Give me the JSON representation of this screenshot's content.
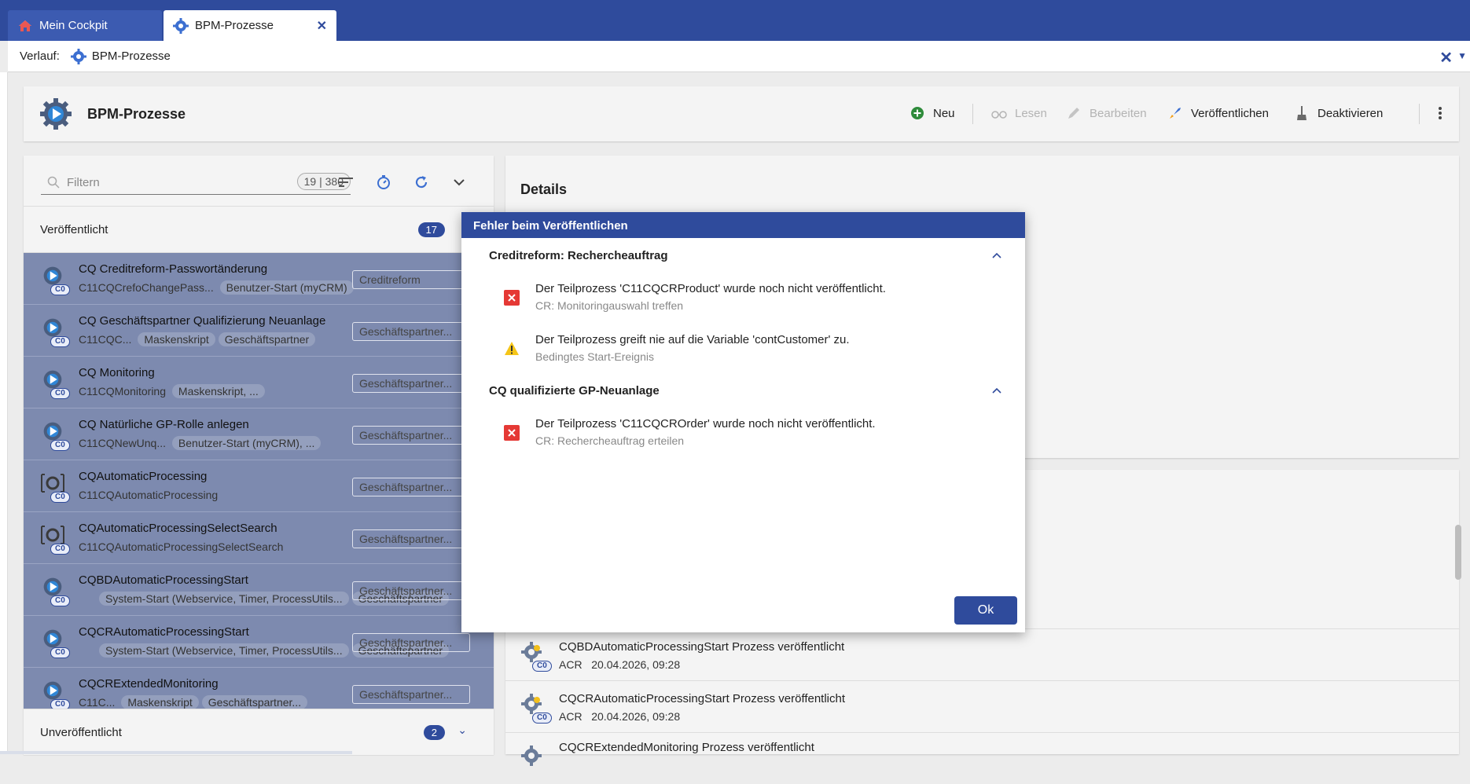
{
  "tabs": [
    {
      "label": "Mein Cockpit"
    },
    {
      "label": "BPM-Prozesse"
    }
  ],
  "history": {
    "label": "Verlauf:",
    "item": "BPM-Prozesse"
  },
  "header": {
    "title": "BPM-Prozesse",
    "actions": {
      "new": "Neu",
      "read": "Lesen",
      "edit": "Bearbeiten",
      "publish": "Veröffentlichen",
      "deactivate": "Deaktivieren"
    }
  },
  "filter": {
    "placeholder": "Filtern",
    "count": "19 | 380"
  },
  "sections": {
    "published": {
      "label": "Veröffentlicht",
      "count": "17"
    },
    "unpublished": {
      "label": "Unveröffentlicht",
      "count": "2"
    }
  },
  "rows": [
    {
      "name": "CQ Creditreform-Passwortänderung",
      "sub": "C11CQCrefoChangePass...",
      "chips": [
        "Benutzer-Start (myCRM)"
      ],
      "box": "Creditreform",
      "badge": "C0"
    },
    {
      "name": "CQ Geschäftspartner Qualifizierung Neuanlage",
      "sub": "C11CQC...",
      "chips": [
        "Maskenskript",
        "Geschäftspartner"
      ],
      "box": "Geschäftspartner...",
      "badge": "C0"
    },
    {
      "name": "CQ Monitoring",
      "sub": "C11CQMonitoring",
      "chips": [
        "Maskenskript, ..."
      ],
      "box": "Geschäftspartner...",
      "badge": "C0"
    },
    {
      "name": "CQ Natürliche GP-Rolle anlegen",
      "sub": "C11CQNewUnq...",
      "chips": [
        "Benutzer-Start (myCRM), ..."
      ],
      "box": "Geschäftspartner...",
      "badge": "C0"
    },
    {
      "name": "CQAutomaticProcessing",
      "sub": "C11CQAutomaticProcessing",
      "chips": [],
      "box": "Geschäftspartner...",
      "badge": "C0"
    },
    {
      "name": "CQAutomaticProcessingSelectSearch",
      "sub": "C11CQAutomaticProcessingSelectSearch",
      "chips": [],
      "box": "Geschäftspartner...",
      "badge": "C0"
    },
    {
      "name": "CQBDAutomaticProcessingStart",
      "sub": "",
      "chips": [
        "System-Start (Webservice, Timer, ProcessUtils...",
        "Geschäftspartner"
      ],
      "box": "Geschäftspartner...",
      "badge": "C0"
    },
    {
      "name": "CQCRAutomaticProcessingStart",
      "sub": "",
      "chips": [
        "System-Start (Webservice, Timer, ProcessUtils...",
        "Geschäftspartner"
      ],
      "box": "Geschäftspartner...",
      "badge": "C0"
    },
    {
      "name": "CQCRExtendedMonitoring",
      "sub": "C11C...",
      "chips": [
        "Maskenskript",
        "Geschäftspartner..."
      ],
      "box": "Geschäftspartner...",
      "badge": "C0"
    }
  ],
  "details": {
    "title": "Details"
  },
  "history_entries": [
    {
      "title": "CQBDAutomaticProcessingStart Prozess veröffentlicht",
      "user": "ACR",
      "date": "20.04.2026, 09:28",
      "badge": "C0"
    },
    {
      "title": "CQCRAutomaticProcessingStart Prozess veröffentlicht",
      "user": "ACR",
      "date": "20.04.2026, 09:28",
      "badge": "C0"
    },
    {
      "title": "CQCRExtendedMonitoring Prozess veröffentlicht",
      "user": "",
      "date": "",
      "badge": ""
    }
  ],
  "dialog": {
    "title": "Fehler beim Veröffentlichen",
    "groups": [
      {
        "label": "Creditreform: Rechercheauftrag",
        "messages": [
          {
            "type": "error",
            "text": "Der Teilprozess 'C11CQCRProduct' wurde noch nicht veröffentlicht.",
            "sub": "CR: Monitoringauswahl treffen"
          },
          {
            "type": "warning",
            "text": "Der Teilprozess greift nie auf die Variable 'contCustomer' zu.",
            "sub": "Bedingtes Start-Ereignis"
          }
        ]
      },
      {
        "label": "CQ qualifizierte GP-Neuanlage",
        "messages": [
          {
            "type": "error",
            "text": "Der Teilprozess 'C11CQCROrder' wurde noch nicht veröffentlicht.",
            "sub": "CR: Rechercheauftrag erteilen"
          }
        ]
      }
    ],
    "ok": "Ok"
  },
  "colors": {
    "brand": "#2f4b9c",
    "error": "#e53935",
    "warning": "#f5c518",
    "selection": "#7d8aaf"
  }
}
